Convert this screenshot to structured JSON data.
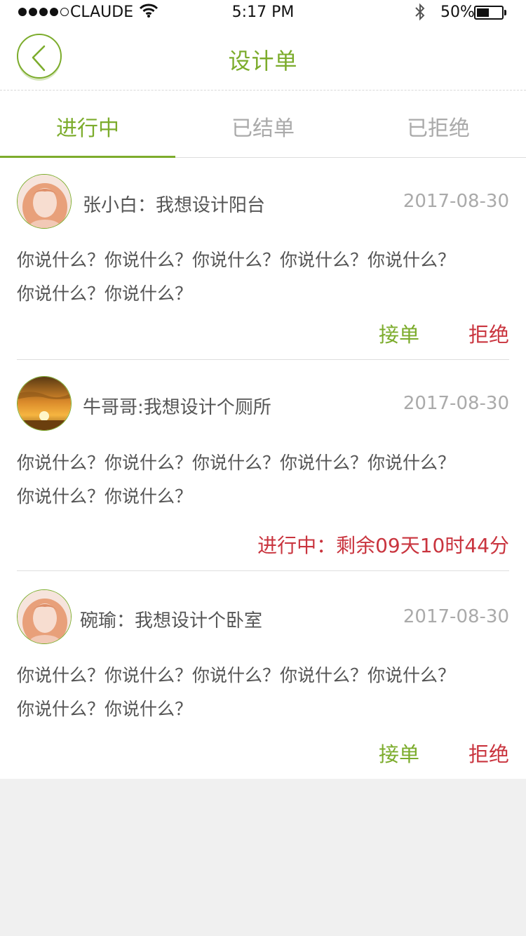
{
  "status_bar": {
    "carrier": "CLAUDE",
    "time": "5:17 PM",
    "battery": "50%",
    "battery_level": 0.5
  },
  "nav": {
    "back_icon": "chevron-left-icon",
    "title": "设计单"
  },
  "tabs": [
    {
      "label": "进行中",
      "active": true
    },
    {
      "label": "已结单",
      "active": false
    },
    {
      "label": "已拒绝",
      "active": false
    }
  ],
  "orders": [
    {
      "avatar": "girl-portrait",
      "name": "张小白：",
      "request": "我想设计阳台",
      "date": "2017-08-30",
      "message_line1": "你说什么？你说什么？你说什么？你说什么？你说什么？",
      "message_line2": "你说什么？你说什么？",
      "accept_label": "接单",
      "reject_label": "拒绝"
    },
    {
      "avatar": "sunset-photo",
      "name": "牛哥哥:",
      "request": "我想设计个厕所",
      "date": "2017-08-30",
      "message_line1": "你说什么？你说什么？你说什么？你说什么？你说什么？",
      "message_line2": "你说什么？你说什么？",
      "status_text": "进行中：剩余09天10时44分"
    },
    {
      "avatar": "girl-portrait",
      "name": "碗瑜：",
      "request": "我想设计个卧室",
      "date": "2017-08-30",
      "message_line1": "你说什么？你说什么？你说什么？你说什么？你说什么？",
      "message_line2": "你说什么？你说什么？",
      "accept_label": "接单",
      "reject_label": "拒绝"
    }
  ],
  "colors": {
    "accent_green": "#7cac2c",
    "reject_red": "#c9343e",
    "muted_gray": "#aaaaaa"
  }
}
